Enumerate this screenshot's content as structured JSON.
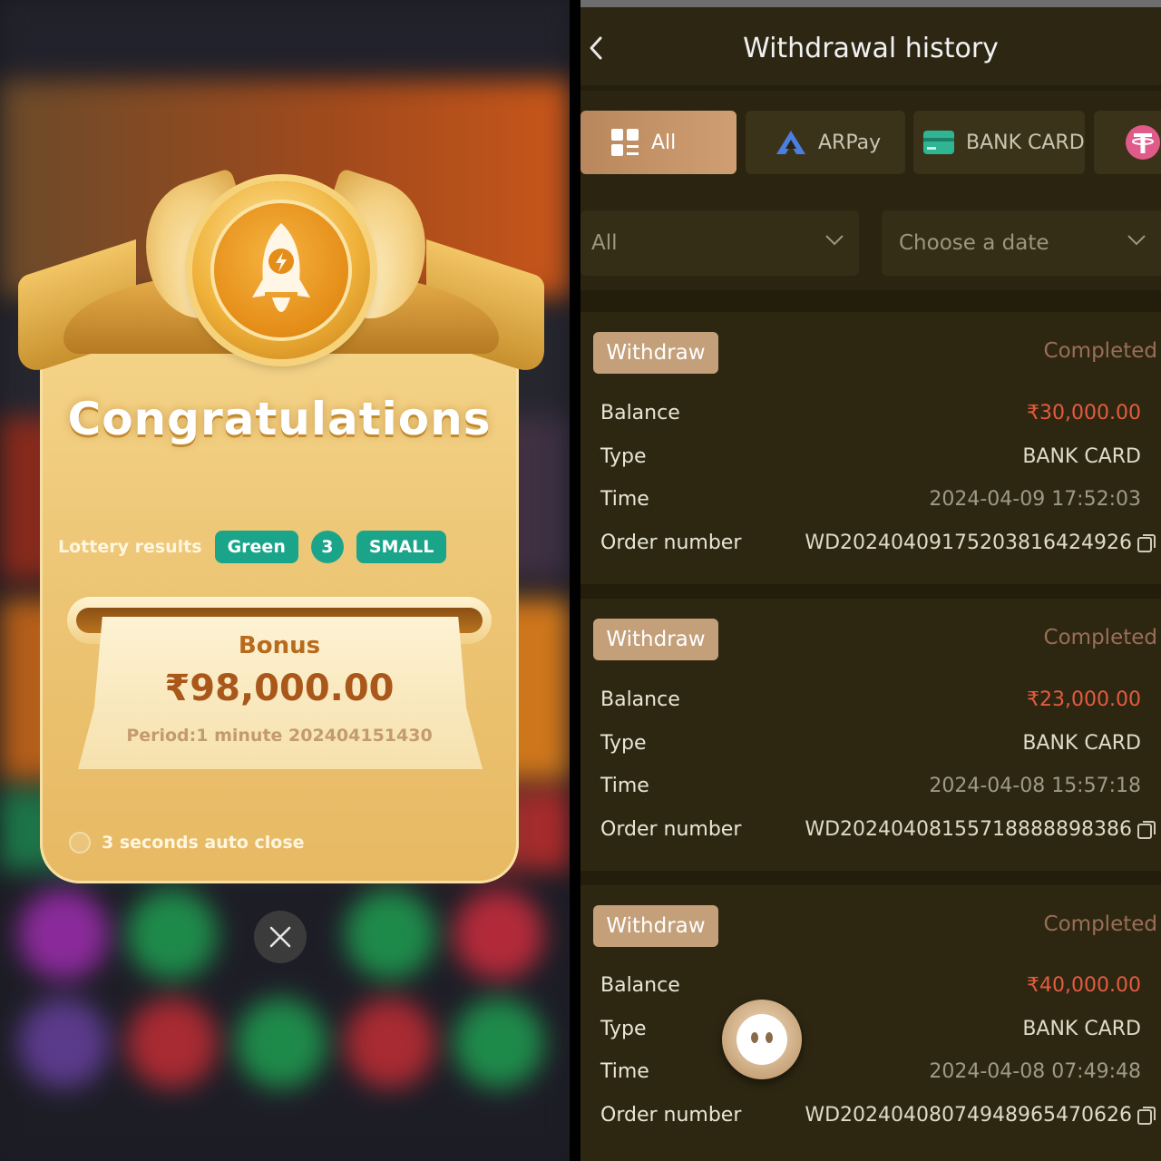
{
  "left": {
    "popup": {
      "title": "Congratulations",
      "lottery_label": "Lottery results",
      "results": [
        "Green",
        "3",
        "SMALL"
      ],
      "bonus_label": "Bonus",
      "bonus_amount": "₹98,000.00",
      "period": "Period:1 minute 202404151430",
      "auto_close": "3 seconds auto close"
    },
    "colors": {
      "result_pill": "#1aa58a",
      "card_gold": "#edc676"
    }
  },
  "right": {
    "header": {
      "title": "Withdrawal history"
    },
    "tabs": [
      {
        "label": "All",
        "icon": "grid-icon",
        "active": true
      },
      {
        "label": "ARPay",
        "icon": "arpay-logo-icon",
        "active": false
      },
      {
        "label": "BANK CARD",
        "icon": "bank-card-icon",
        "active": false
      },
      {
        "label": "",
        "icon": "tether-icon",
        "active": false
      }
    ],
    "filters": {
      "status": "All",
      "date": "Choose a date"
    },
    "field_labels": {
      "balance": "Balance",
      "type": "Type",
      "time": "Time",
      "order": "Order number"
    },
    "records": [
      {
        "badge": "Withdraw",
        "status": "Completed",
        "balance": "₹30,000.00",
        "type": "BANK CARD",
        "time": "2024-04-09 17:52:03",
        "order": "WD20240409175203816424926"
      },
      {
        "badge": "Withdraw",
        "status": "Completed",
        "balance": "₹23,000.00",
        "type": "BANK CARD",
        "time": "2024-04-08 15:57:18",
        "order": "WD20240408155718888898386"
      },
      {
        "badge": "Withdraw",
        "status": "Completed",
        "balance": "₹40,000.00",
        "type": "BANK CARD",
        "time": "2024-04-08 07:49:48",
        "order": "WD20240408074948965470626"
      }
    ],
    "colors": {
      "accent": "#c4a07a",
      "amount": "#e55b3f",
      "status": "#9a6e55"
    }
  }
}
